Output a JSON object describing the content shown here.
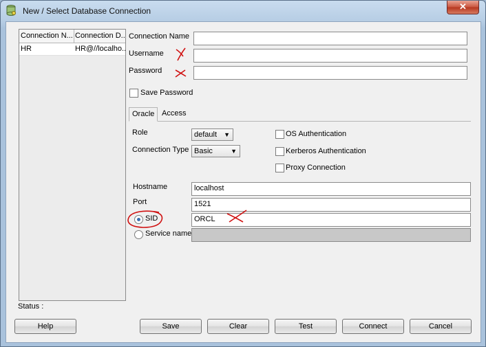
{
  "window": {
    "title": "New / Select Database Connection",
    "close_glyph": "✕"
  },
  "connections": {
    "headers": [
      "Connection N...",
      "Connection D..."
    ],
    "rows": [
      {
        "name": "HR",
        "details": "HR@//localho..."
      }
    ]
  },
  "form": {
    "connection_name_label": "Connection Name",
    "username_label": "Username",
    "password_label": "Password",
    "connection_name_value": "",
    "username_value": "",
    "password_value": "",
    "save_password_label": "Save Password",
    "save_password_checked": false
  },
  "tabs": {
    "oracle": "Oracle",
    "access": "Access",
    "active": "oracle"
  },
  "oracle": {
    "role_label": "Role",
    "role_value": "default",
    "connection_type_label": "Connection Type",
    "connection_type_value": "Basic",
    "os_auth_label": "OS Authentication",
    "kerberos_label": "Kerberos Authentication",
    "proxy_label": "Proxy Connection",
    "hostname_label": "Hostname",
    "hostname_value": "localhost",
    "port_label": "Port",
    "port_value": "1521",
    "sid_label": "SID",
    "sid_value": "ORCL",
    "sid_selected": true,
    "service_name_label": "Service name",
    "service_name_value": ""
  },
  "status_label": "Status :",
  "buttons": {
    "help": "Help",
    "save": "Save",
    "clear": "Clear",
    "test": "Test",
    "connect": "Connect",
    "cancel": "Cancel"
  },
  "annotation_color": "#d01010"
}
